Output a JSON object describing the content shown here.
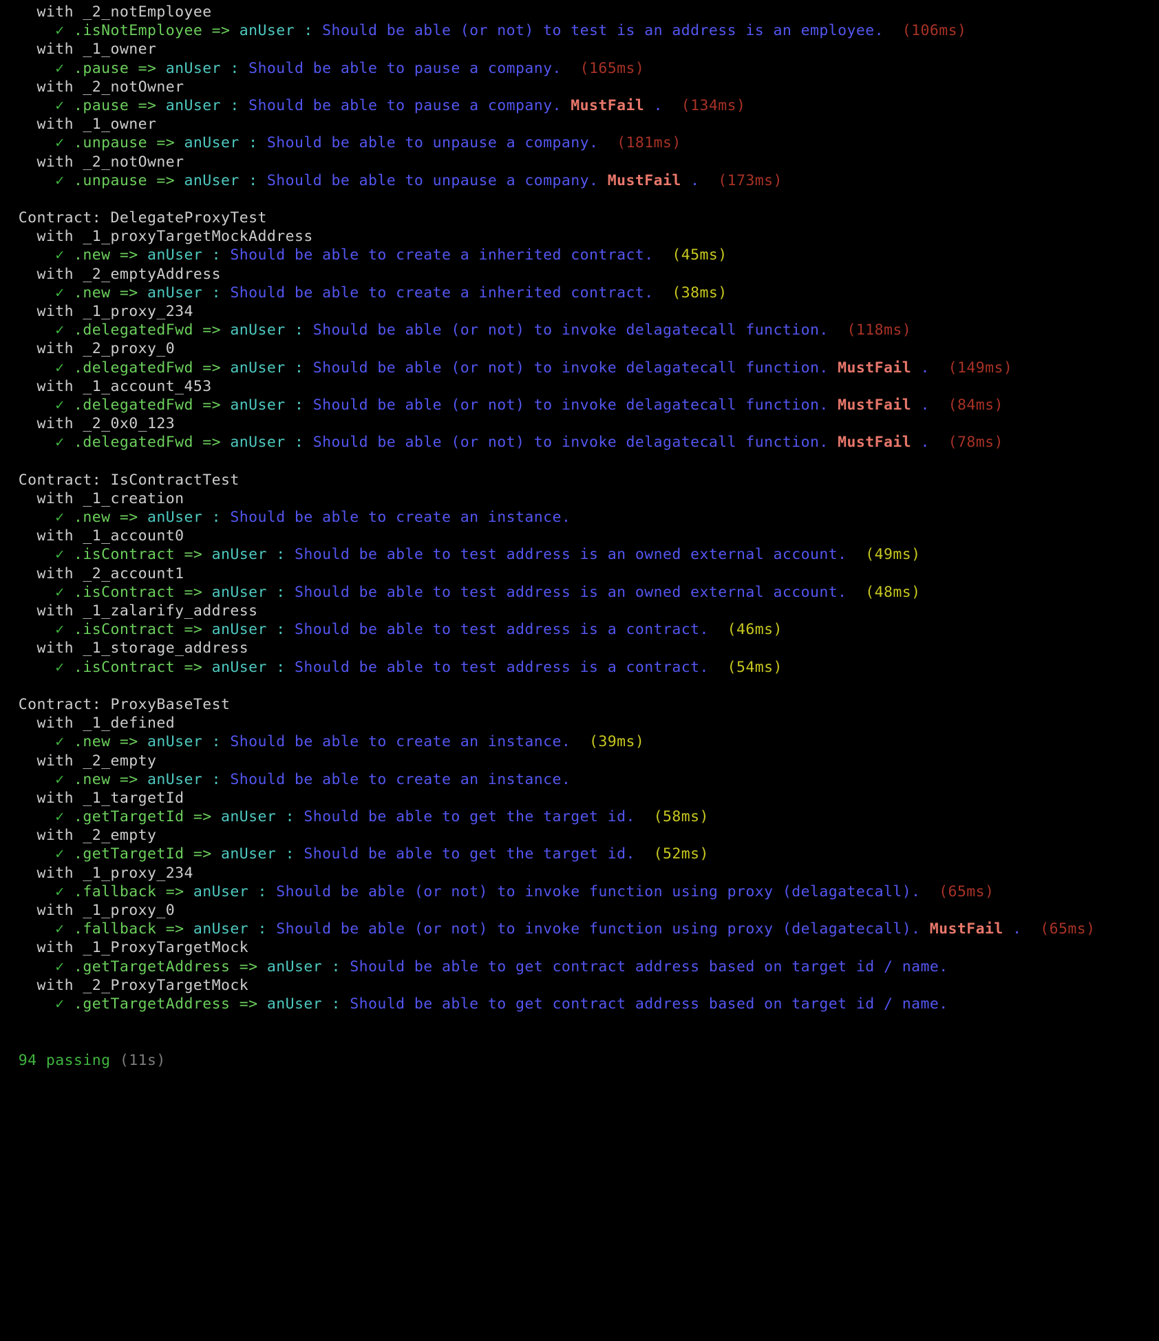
{
  "terminal": {
    "reporter": "mocha-spec",
    "colors": {
      "background": "#000000",
      "suite": "#cdcdcd",
      "context": "#cdcdcd",
      "checkmark": "#3fb53f",
      "method": "#6ccf5c",
      "actor": "#4ec9c0",
      "description": "#5356f0",
      "mustfail": "#e8776b",
      "duration_slow": "#a93226",
      "duration_medium": "#c8c820",
      "passing": "#3fb53f",
      "total_time": "#7d7d7d"
    },
    "symbols": {
      "check": "✓",
      "arrow": "=>",
      "colon": ":",
      "period": "."
    }
  },
  "groups": [
    {
      "suite": null,
      "entries": [
        {
          "context": "with _2_notEmployee",
          "test": {
            "method": ".isNotEmployee",
            "actor": "anUser",
            "desc": "Should be able (or not) to test is an address is an employee.",
            "mustfail": false,
            "duration": "(106ms)",
            "speed": "slow"
          }
        },
        {
          "context": "with _1_owner",
          "test": {
            "method": ".pause",
            "actor": "anUser",
            "desc": "Should be able to pause a company.",
            "mustfail": false,
            "duration": "(165ms)",
            "speed": "slow"
          }
        },
        {
          "context": "with _2_notOwner",
          "test": {
            "method": ".pause",
            "actor": "anUser",
            "desc": "Should be able to pause a company.",
            "mustfail": true,
            "duration": "(134ms)",
            "speed": "slow"
          }
        },
        {
          "context": "with _1_owner",
          "test": {
            "method": ".unpause",
            "actor": "anUser",
            "desc": "Should be able to unpause a company.",
            "mustfail": false,
            "duration": "(181ms)",
            "speed": "slow"
          }
        },
        {
          "context": "with _2_notOwner",
          "test": {
            "method": ".unpause",
            "actor": "anUser",
            "desc": "Should be able to unpause a company.",
            "mustfail": true,
            "duration": "(173ms)",
            "speed": "slow"
          }
        }
      ]
    },
    {
      "suite": "Contract: DelegateProxyTest",
      "entries": [
        {
          "context": "with _1_proxyTargetMockAddress",
          "test": {
            "method": ".new",
            "actor": "anUser",
            "desc": "Should be able to create a inherited contract.",
            "mustfail": false,
            "duration": "(45ms)",
            "speed": "medium"
          }
        },
        {
          "context": "with _2_emptyAddress",
          "test": {
            "method": ".new",
            "actor": "anUser",
            "desc": "Should be able to create a inherited contract.",
            "mustfail": false,
            "duration": "(38ms)",
            "speed": "medium"
          }
        },
        {
          "context": "with _1_proxy_234",
          "test": {
            "method": ".delegatedFwd",
            "actor": "anUser",
            "desc": "Should be able (or not) to invoke delagatecall function.",
            "mustfail": false,
            "duration": "(118ms)",
            "speed": "slow"
          }
        },
        {
          "context": "with _2_proxy_0",
          "test": {
            "method": ".delegatedFwd",
            "actor": "anUser",
            "desc": "Should be able (or not) to invoke delagatecall function.",
            "mustfail": true,
            "duration": "(149ms)",
            "speed": "slow"
          }
        },
        {
          "context": "with _1_account_453",
          "test": {
            "method": ".delegatedFwd",
            "actor": "anUser",
            "desc": "Should be able (or not) to invoke delagatecall function.",
            "mustfail": true,
            "duration": "(84ms)",
            "speed": "slow"
          }
        },
        {
          "context": "with _2_0x0_123",
          "test": {
            "method": ".delegatedFwd",
            "actor": "anUser",
            "desc": "Should be able (or not) to invoke delagatecall function.",
            "mustfail": true,
            "duration": "(78ms)",
            "speed": "slow"
          }
        }
      ]
    },
    {
      "suite": "Contract: IsContractTest",
      "entries": [
        {
          "context": "with _1_creation",
          "test": {
            "method": ".new",
            "actor": "anUser",
            "desc": "Should be able to create an instance.",
            "mustfail": false,
            "duration": null,
            "speed": "fast"
          }
        },
        {
          "context": "with _1_account0",
          "test": {
            "method": ".isContract",
            "actor": "anUser",
            "desc": "Should be able to test address is an owned external account.",
            "mustfail": false,
            "duration": "(49ms)",
            "speed": "medium"
          }
        },
        {
          "context": "with _2_account1",
          "test": {
            "method": ".isContract",
            "actor": "anUser",
            "desc": "Should be able to test address is an owned external account.",
            "mustfail": false,
            "duration": "(48ms)",
            "speed": "medium"
          }
        },
        {
          "context": "with _1_zalarify_address",
          "test": {
            "method": ".isContract",
            "actor": "anUser",
            "desc": "Should be able to test address is a contract.",
            "mustfail": false,
            "duration": "(46ms)",
            "speed": "medium"
          }
        },
        {
          "context": "with _1_storage_address",
          "test": {
            "method": ".isContract",
            "actor": "anUser",
            "desc": "Should be able to test address is a contract.",
            "mustfail": false,
            "duration": "(54ms)",
            "speed": "medium"
          }
        }
      ]
    },
    {
      "suite": "Contract: ProxyBaseTest",
      "entries": [
        {
          "context": "with _1_defined",
          "test": {
            "method": ".new",
            "actor": "anUser",
            "desc": "Should be able to create an instance.",
            "mustfail": false,
            "duration": "(39ms)",
            "speed": "medium"
          }
        },
        {
          "context": "with _2_empty",
          "test": {
            "method": ".new",
            "actor": "anUser",
            "desc": "Should be able to create an instance.",
            "mustfail": false,
            "duration": null,
            "speed": "fast"
          }
        },
        {
          "context": "with _1_targetId",
          "test": {
            "method": ".getTargetId",
            "actor": "anUser",
            "desc": "Should be able to get the target id.",
            "mustfail": false,
            "duration": "(58ms)",
            "speed": "medium"
          }
        },
        {
          "context": "with _2_empty",
          "test": {
            "method": ".getTargetId",
            "actor": "anUser",
            "desc": "Should be able to get the target id.",
            "mustfail": false,
            "duration": "(52ms)",
            "speed": "medium"
          }
        },
        {
          "context": "with _1_proxy_234",
          "test": {
            "method": ".fallback",
            "actor": "anUser",
            "desc": "Should be able (or not) to invoke function using proxy (delagatecall).",
            "mustfail": false,
            "duration": "(65ms)",
            "speed": "slow"
          }
        },
        {
          "context": "with _1_proxy_0",
          "test": {
            "method": ".fallback",
            "actor": "anUser",
            "desc": "Should be able (or not) to invoke function using proxy (delagatecall).",
            "mustfail": true,
            "duration": "(65ms)",
            "speed": "slow"
          }
        },
        {
          "context": "with _1_ProxyTargetMock",
          "test": {
            "method": ".getTargetAddress",
            "actor": "anUser",
            "desc": "Should be able to get contract address based on target id / name.",
            "mustfail": false,
            "duration": null,
            "speed": "fast"
          }
        },
        {
          "context": "with _2_ProxyTargetMock",
          "test": {
            "method": ".getTargetAddress",
            "actor": "anUser",
            "desc": "Should be able to get contract address based on target id / name.",
            "mustfail": false,
            "duration": null,
            "speed": "fast"
          }
        }
      ]
    }
  ],
  "summary": {
    "passing_label": "94 passing",
    "passing_count": 94,
    "total_time": "(11s)"
  }
}
